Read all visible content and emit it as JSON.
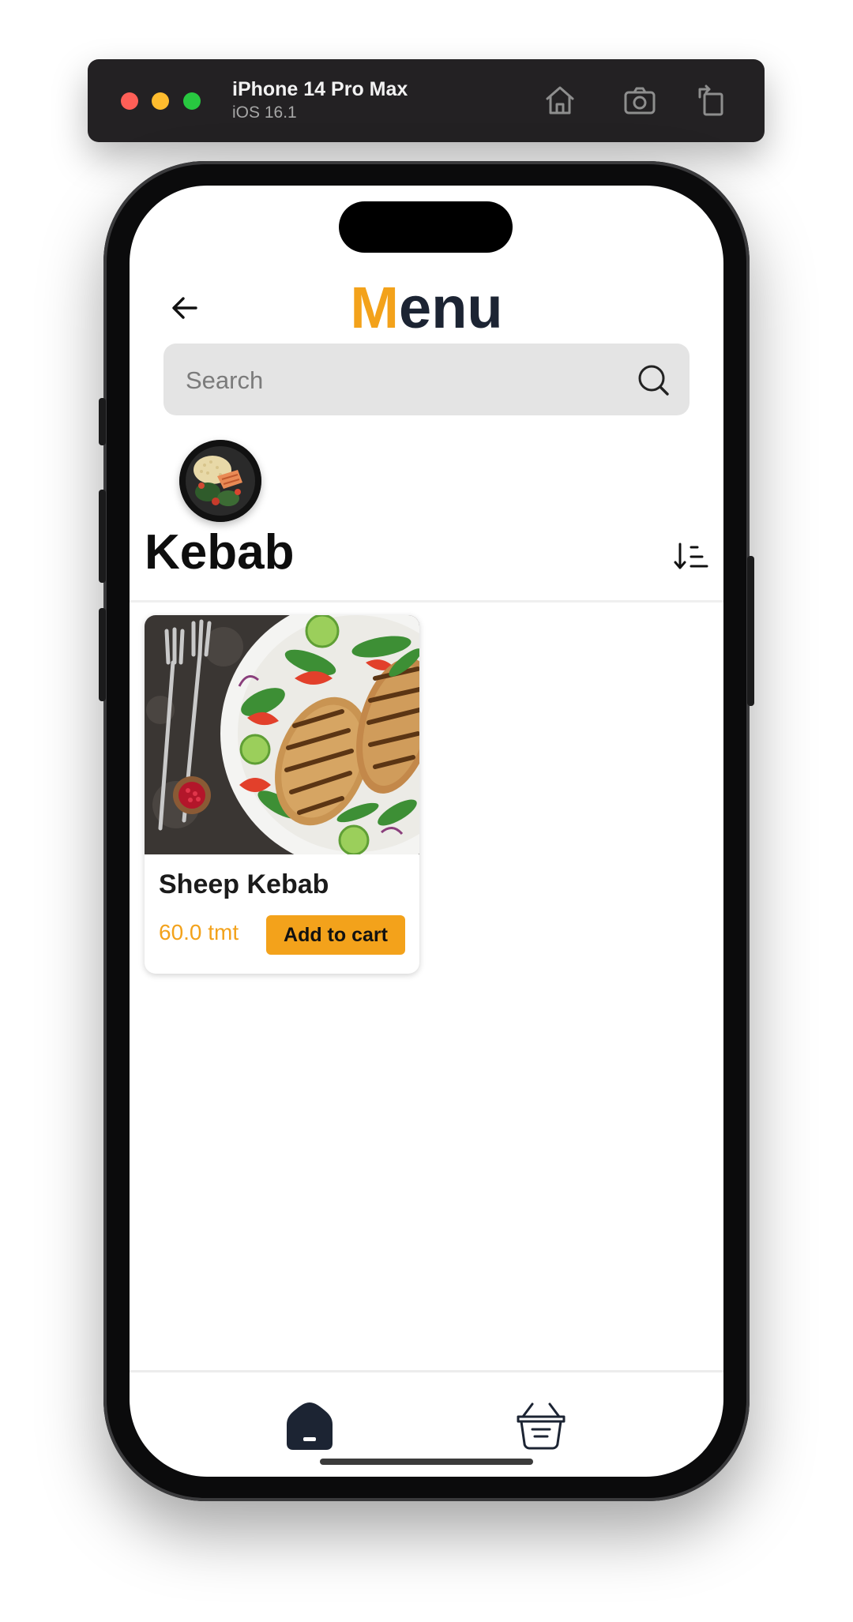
{
  "simulator": {
    "device_name": "iPhone 14 Pro Max",
    "os_version": "iOS 16.1",
    "buttons": [
      "home-icon",
      "screenshot-icon",
      "rotate-icon"
    ]
  },
  "header": {
    "title_accent": "M",
    "title_rest": "enu",
    "back_icon": "arrow-left-icon"
  },
  "search": {
    "placeholder": "Search",
    "value": "",
    "icon": "search-icon"
  },
  "category": {
    "name": "Kebab",
    "sort_icon": "sort-descending-icon"
  },
  "products": [
    {
      "name": "Sheep Kebab",
      "price": "60.0 tmt",
      "button_label": "Add to cart"
    }
  ],
  "tab_bar": {
    "items": [
      "home-icon",
      "cart-basket-icon"
    ],
    "active": "home-icon"
  },
  "colors": {
    "accent": "#f3a21b",
    "title_dark": "#1c2433",
    "search_bg": "#e4e4e4"
  }
}
